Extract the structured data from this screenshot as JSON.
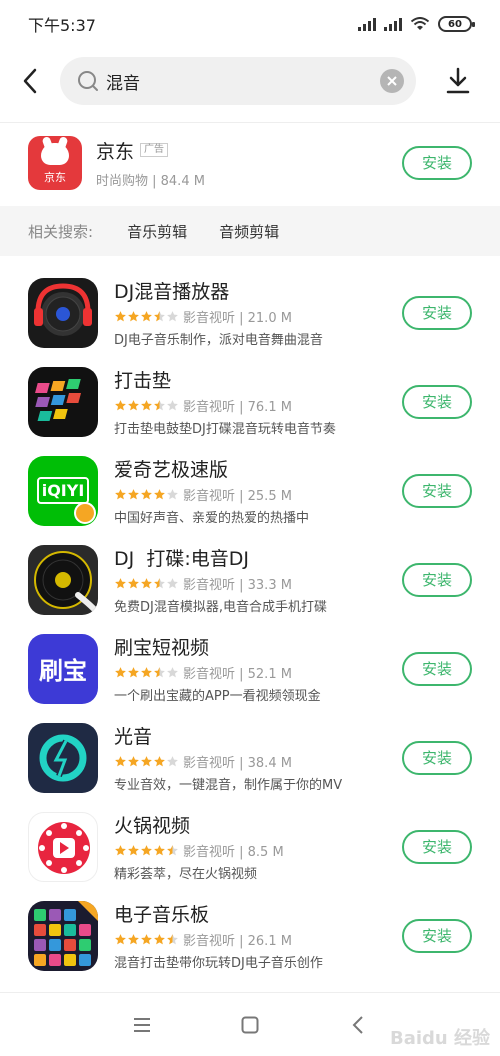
{
  "status_bar": {
    "time": "下午5:37",
    "battery": "60"
  },
  "search": {
    "query": "混音"
  },
  "ad": {
    "name": "京东",
    "badge": "广告",
    "meta": "时尚购物 | 84.4 M",
    "icon_label": "京东",
    "install_label": "安装"
  },
  "related": {
    "label": "相关搜索:",
    "items": [
      "音乐剪辑",
      "音频剪辑"
    ]
  },
  "apps": [
    {
      "name": "DJ混音播放器",
      "rating": 3.5,
      "meta": "影音视听 | 21.0 M",
      "desc": "DJ电子音乐制作，派对电音舞曲混音",
      "install": "安装"
    },
    {
      "name": "打击垫",
      "rating": 3.5,
      "meta": "影音视听 | 76.1 M",
      "desc": "打击垫电鼓垫DJ打碟混音玩转电音节奏",
      "install": "安装"
    },
    {
      "name": "爱奇艺极速版",
      "rating": 4,
      "meta": "影音视听 | 25.5 M",
      "desc": "中国好声音、亲爱的热爱的热播中",
      "install": "安装",
      "icon_text": "iQIYI"
    },
    {
      "name": "DJ  打碟:电音DJ",
      "rating": 3.5,
      "meta": "影音视听 | 33.3 M",
      "desc": "免费DJ混音模拟器,电音合成手机打碟",
      "install": "安装"
    },
    {
      "name": "刷宝短视频",
      "rating": 3.5,
      "meta": "影音视听 | 52.1 M",
      "desc": "一个刷出宝藏的APP一看视频领现金",
      "install": "安装",
      "icon_text": "刷宝"
    },
    {
      "name": "光音",
      "rating": 4,
      "meta": "影音视听 | 38.4 M",
      "desc": "专业音效，一键混音，制作属于你的MV",
      "install": "安装"
    },
    {
      "name": "火锅视频",
      "rating": 4.5,
      "meta": "影音视听 | 8.5 M",
      "desc": "精彩荟萃，尽在火锅视频",
      "install": "安装"
    },
    {
      "name": "电子音乐板",
      "rating": 4.5,
      "meta": "影音视听 | 26.1 M",
      "desc": "混音打击垫带你玩转DJ电子音乐创作",
      "install": "安装"
    }
  ],
  "colors": {
    "accent": "#3db66d",
    "star": "#f5a623",
    "jd_red": "#e4393c"
  },
  "watermark": "Baidu 经验"
}
